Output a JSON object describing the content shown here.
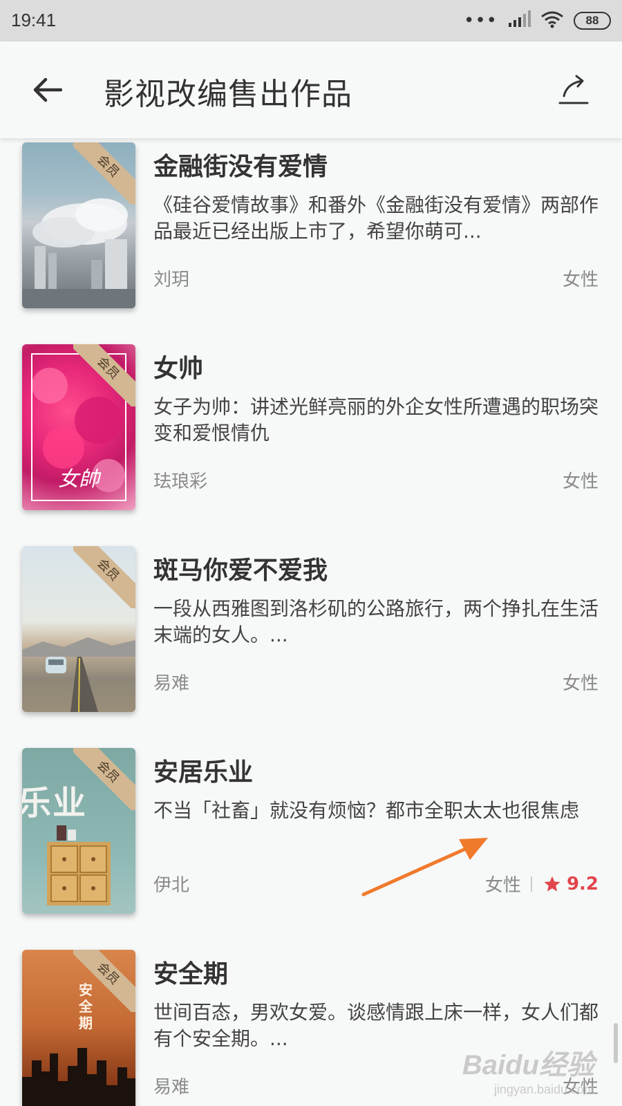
{
  "status_bar": {
    "time": "19:41",
    "battery": "88",
    "dots": "•••"
  },
  "app_bar": {
    "title": "影视改编售出作品",
    "back_icon": "arrow-left-icon",
    "share_icon": "share-icon"
  },
  "colors": {
    "accent": "#e0464c",
    "ribbon": "#d2b792",
    "background": "#f7f8f8",
    "annotation_arrow": "#f07a2c"
  },
  "badge_label": "会员",
  "books": [
    {
      "title": "金融街没有爱情",
      "desc": "《硅谷爱情故事》和番外《金融街没有爱情》两部作品最近已经出版上市了，希望你萌可...",
      "author": "刘玥",
      "category": "女性"
    },
    {
      "title": "女帅",
      "desc": "女子为帅：讲述光鲜亮丽的外企女性所遭遇的职场突变和爱恨情仇",
      "author": "珐琅彩",
      "category": "女性",
      "cover_text": "女帥"
    },
    {
      "title": "斑马你爱不爱我",
      "desc": "一段从西雅图到洛杉矶的公路旅行，两个挣扎在生活末端的女人。...",
      "author": "易难",
      "category": "女性"
    },
    {
      "title": "安居乐业",
      "desc": "不当「社畜」就没有烦恼？都市全职太太也很焦虑",
      "author": "伊北",
      "category": "女性",
      "rating": "9.2",
      "cover_text": "乐业"
    },
    {
      "title": "安全期",
      "desc": "世间百态，男欢女爱。谈感情跟上床一样，女人们都有个安全期。...",
      "author": "易难",
      "category": "女性",
      "cover_text": "安全期"
    }
  ],
  "watermark": {
    "logo": "Baidu经验",
    "url": "jingyan.baidu.com"
  }
}
